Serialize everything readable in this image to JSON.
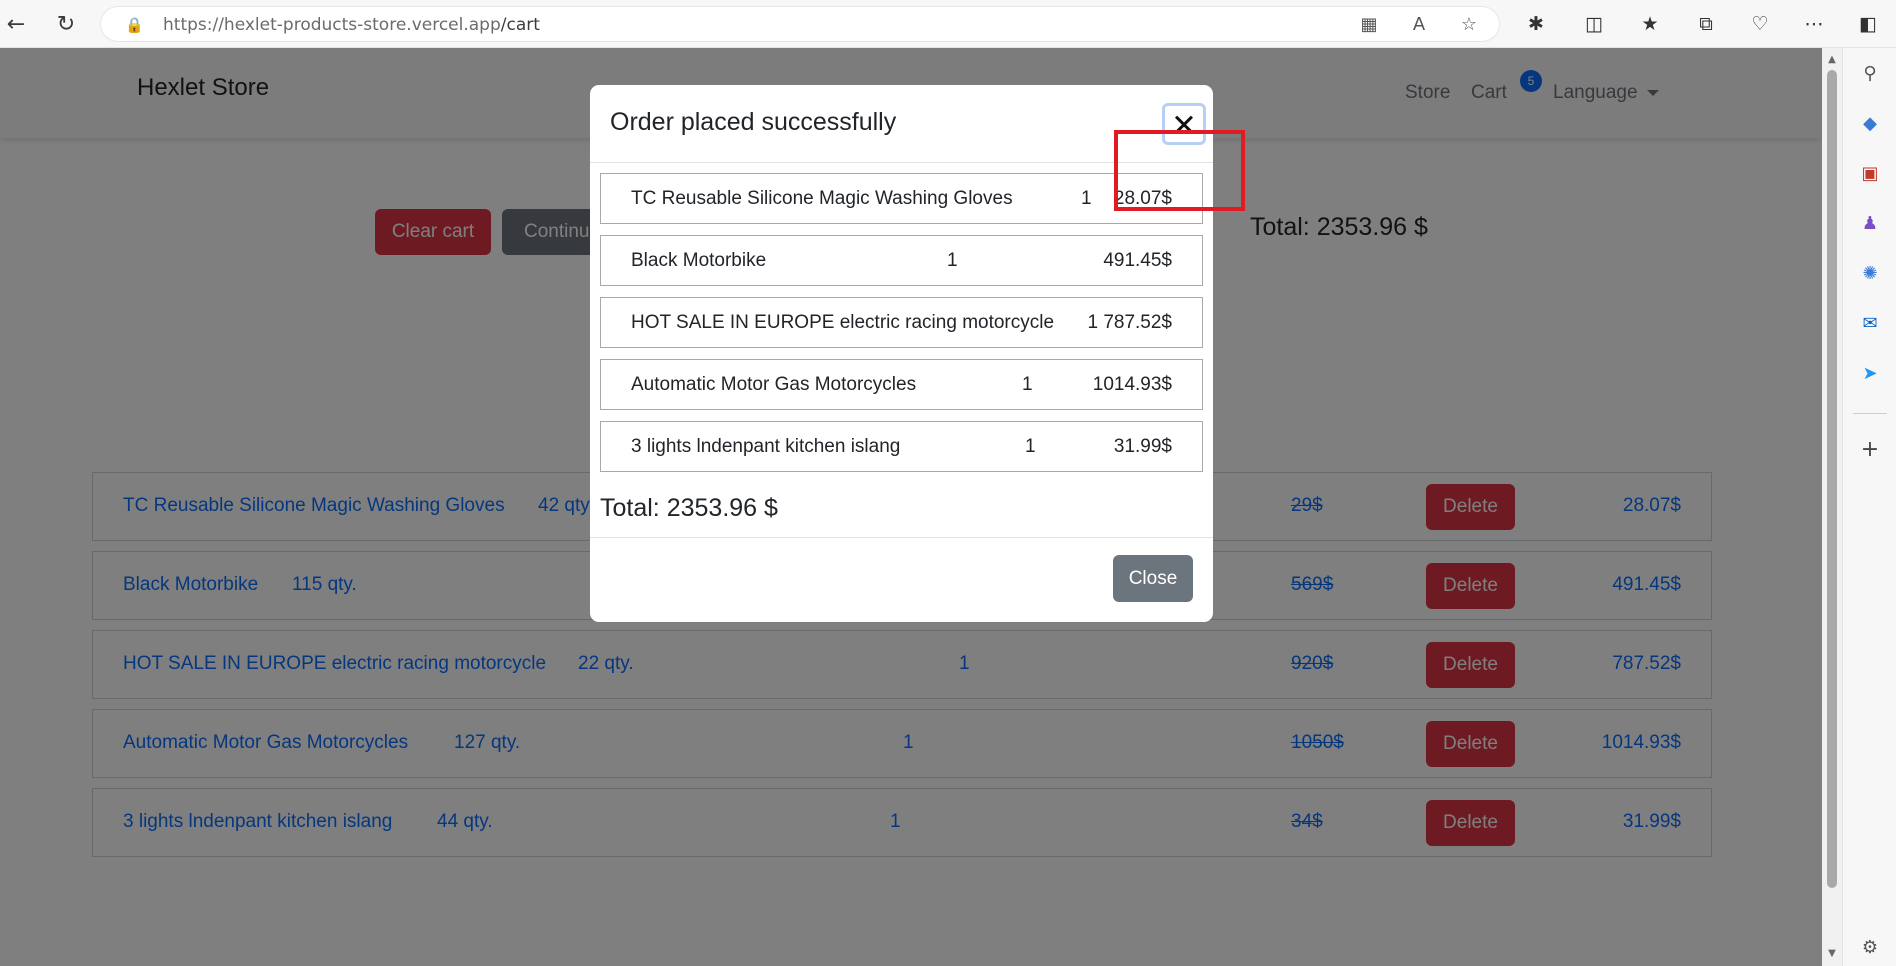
{
  "browser": {
    "url_host": "https://hexlet-products-store.vercel.app",
    "url_path": "/cart"
  },
  "site": {
    "brand": "Hexlet Store",
    "nav": {
      "store": "Store",
      "cart": "Cart",
      "cart_count": "5",
      "language": "Language"
    }
  },
  "actions": {
    "clear_cart": "Clear cart",
    "continue": "Continue"
  },
  "page_total": "Total: 2353.96 $",
  "cart_rows": [
    {
      "name": "TC Reusable Silicone Magic Washing Gloves",
      "stock": "42 qty.",
      "count": "",
      "old_price": "29$",
      "delete": "Delete",
      "price": "28.07$"
    },
    {
      "name": "Black Motorbike",
      "stock": "115 qty.",
      "count": "",
      "old_price": "569$",
      "delete": "Delete",
      "price": "491.45$"
    },
    {
      "name": "HOT SALE IN EUROPE electric racing motorcycle",
      "stock": "22 qty.",
      "count": "1",
      "old_price": "920$",
      "delete": "Delete",
      "price": "787.52$"
    },
    {
      "name": "Automatic Motor Gas Motorcycles",
      "stock": "127 qty.",
      "count": "1",
      "old_price": "1050$",
      "delete": "Delete",
      "price": "1014.93$"
    },
    {
      "name": "3 lights lndenpant kitchen islang",
      "stock": "44 qty.",
      "count": "1",
      "old_price": "34$",
      "delete": "Delete",
      "price": "31.99$"
    }
  ],
  "modal": {
    "title": "Order placed successfully",
    "items": [
      {
        "name": "TC Reusable Silicone Magic Washing Gloves",
        "qty": "1",
        "price": "28.07$"
      },
      {
        "name": "Black Motorbike",
        "qty": "1",
        "price": "491.45$"
      },
      {
        "name": "HOT SALE IN EUROPE electric racing motorcycle",
        "qty": "",
        "price": "1 787.52$"
      },
      {
        "name": "Automatic Motor Gas Motorcycles",
        "qty": "1",
        "price": "1014.93$"
      },
      {
        "name": "3 lights lndenpant kitchen islang",
        "qty": "1",
        "price": "31.99$"
      }
    ],
    "total": "Total: 2353.96 $",
    "close_button": "Close"
  },
  "colors": {
    "danger": "#dc3545",
    "secondary": "#6c757d",
    "link": "#0d6efd",
    "highlight": "#e01b24"
  }
}
